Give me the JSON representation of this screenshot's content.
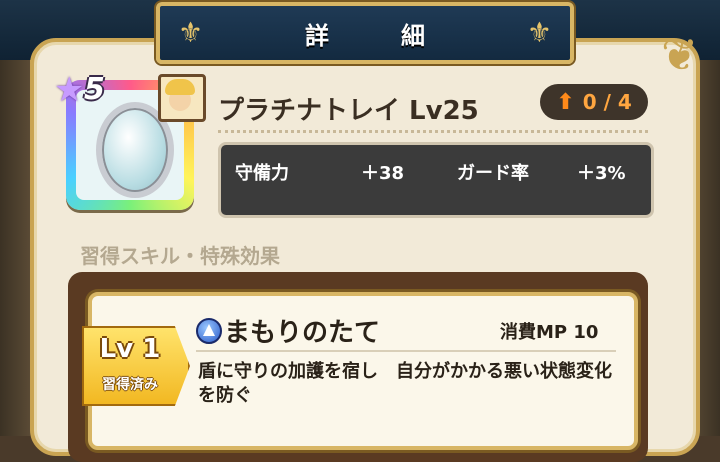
{
  "window": {
    "title": "詳　細"
  },
  "item": {
    "name": "プラチナトレイ Lv25",
    "rarity": "5",
    "upgrade_count": "0 / 4"
  },
  "stats": [
    {
      "label": "守備力",
      "value": "＋38"
    },
    {
      "label": "ガード率",
      "value": "＋3%"
    }
  ],
  "section": {
    "heading": "習得スキル・特殊効果"
  },
  "skill": {
    "level": "Lv 1",
    "status": "習得済み",
    "name": "まもりのたて",
    "cost": "消費MP 10",
    "description": "盾に守りの加護を宿し　自分がかかる悪い状態変化を防ぐ"
  },
  "colors": {
    "header": "#1f3a55",
    "gold": "#c9a453",
    "parchment": "#f2ead8",
    "stats_bg": "#3b3b3b",
    "upgrade_accent": "#ffa640"
  }
}
